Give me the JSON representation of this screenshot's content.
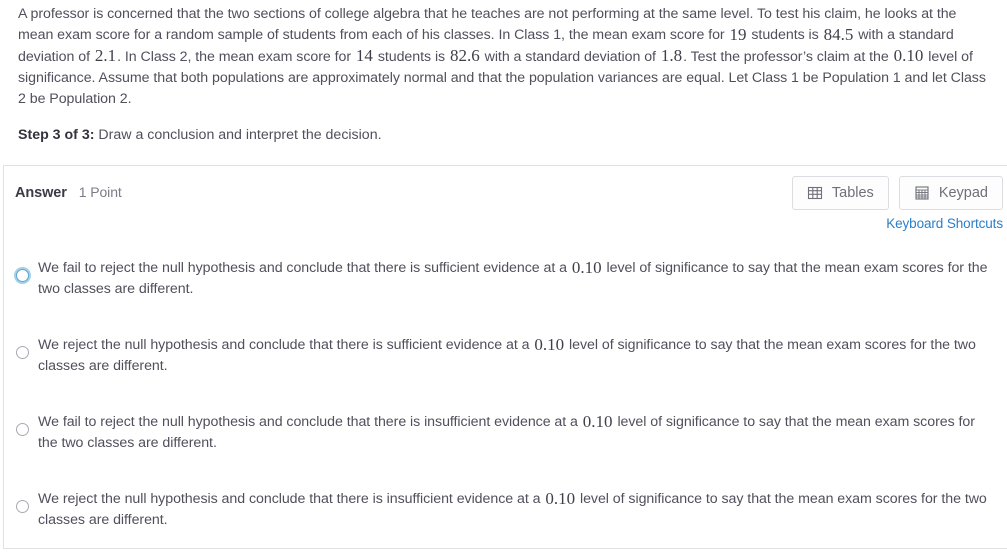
{
  "question": {
    "segments": [
      {
        "t": "A professor is concerned that the two sections of college algebra that he teaches are not performing at the same level. To test his claim, he looks at the mean exam score for a random sample of students from each of his classes. In Class 1, the mean exam score for ",
        "math": false
      },
      {
        "t": "19",
        "math": true
      },
      {
        "t": " students is ",
        "math": false
      },
      {
        "t": "84.5",
        "math": true
      },
      {
        "t": " with a standard deviation of ",
        "math": false
      },
      {
        "t": "2.1",
        "math": true
      },
      {
        "t": ". In Class 2, the mean exam score for ",
        "math": false
      },
      {
        "t": "14",
        "math": true
      },
      {
        "t": " students is ",
        "math": false
      },
      {
        "t": "82.6",
        "math": true
      },
      {
        "t": " with a standard deviation of ",
        "math": false
      },
      {
        "t": "1.8",
        "math": true
      },
      {
        "t": ". Test the professor’s claim at the ",
        "math": false
      },
      {
        "t": "0.10",
        "math": true
      },
      {
        "t": " level of significance. Assume that both populations are approximately normal and that the population variances are equal. Let Class 1 be Population 1 and let Class 2 be Population 2.",
        "math": false
      }
    ],
    "step_label": "Step 3 of 3:",
    "step_text": " Draw a conclusion and interpret the decision."
  },
  "answer": {
    "title": "Answer",
    "points": "1 Point",
    "tables_button": "Tables",
    "keypad_button": "Keypad",
    "keyboard_shortcuts": "Keyboard Shortcuts",
    "link_color": "#2a7fc9",
    "focus_ring_color": "#5ea7cf"
  },
  "options": [
    {
      "selected": false,
      "focused": true,
      "segments": [
        {
          "t": "We fail to reject the null hypothesis and conclude that there is sufficient evidence at a ",
          "math": false
        },
        {
          "t": "0.10",
          "math": true
        },
        {
          "t": " level of significance to say that the mean exam scores for the two classes are different.",
          "math": false
        }
      ]
    },
    {
      "selected": false,
      "focused": false,
      "segments": [
        {
          "t": "We reject the null hypothesis and conclude that there is sufficient evidence at a ",
          "math": false
        },
        {
          "t": "0.10",
          "math": true
        },
        {
          "t": " level of significance to say that the mean exam scores for the two classes are different.",
          "math": false
        }
      ]
    },
    {
      "selected": false,
      "focused": false,
      "segments": [
        {
          "t": "We fail to reject the null hypothesis and conclude that there is insufficient evidence at a ",
          "math": false
        },
        {
          "t": "0.10",
          "math": true
        },
        {
          "t": " level of significance to say that the mean exam scores for the two classes are different.",
          "math": false
        }
      ]
    },
    {
      "selected": false,
      "focused": false,
      "segments": [
        {
          "t": "We reject the null hypothesis and conclude that there is insufficient evidence at a ",
          "math": false
        },
        {
          "t": "0.10",
          "math": true
        },
        {
          "t": " level of significance to say that the mean exam scores for the two classes are different.",
          "math": false
        }
      ]
    }
  ]
}
